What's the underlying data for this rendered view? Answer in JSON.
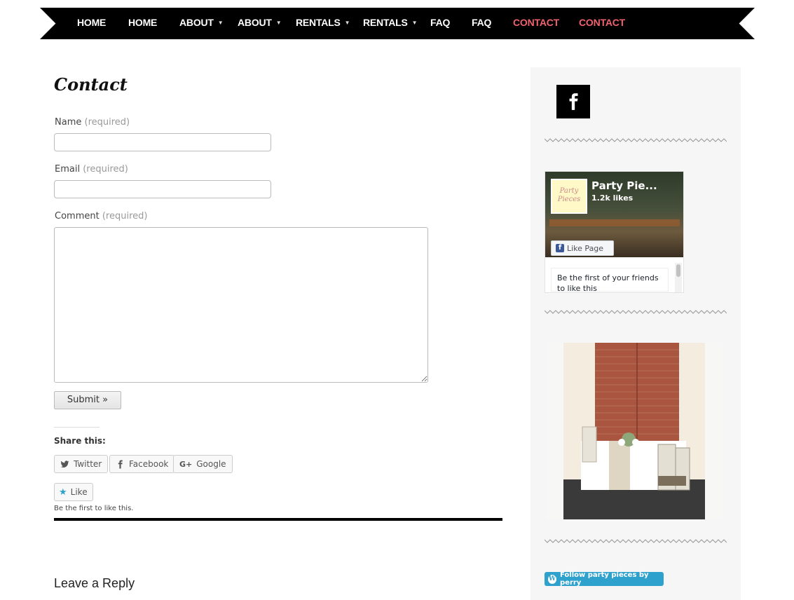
{
  "nav": {
    "items": [
      {
        "label": "HOME",
        "caret": false,
        "active": false
      },
      {
        "label": "HOME",
        "caret": false,
        "active": false
      },
      {
        "label": "ABOUT",
        "caret": true,
        "active": false
      },
      {
        "label": "ABOUT",
        "caret": true,
        "active": false
      },
      {
        "label": "RENTALS",
        "caret": true,
        "active": false
      },
      {
        "label": "RENTALS",
        "caret": true,
        "active": false
      },
      {
        "label": "FAQ",
        "caret": false,
        "active": false
      },
      {
        "label": "FAQ",
        "caret": false,
        "active": false
      },
      {
        "label": "CONTACT",
        "caret": false,
        "active": true
      },
      {
        "label": "CONTACT",
        "caret": false,
        "active": true
      }
    ],
    "caret_glyph": "▼",
    "active_color": "#f0626d"
  },
  "page": {
    "title": "Contact"
  },
  "form": {
    "required_text": "(required)",
    "name_label": "Name",
    "name_value": "",
    "email_label": "Email",
    "email_value": "",
    "comment_label": "Comment",
    "comment_value": "",
    "submit_label": "Submit »"
  },
  "share": {
    "title": "Share this:",
    "twitter": "Twitter",
    "facebook": "Facebook",
    "google": "Google"
  },
  "like": {
    "button_label": "Like",
    "note": "Be the first to like this."
  },
  "comments": {
    "reply_title": "Leave a Reply"
  },
  "sidebar": {
    "facebook_icon": "facebook-icon",
    "fb_page": {
      "name": "Party Pie...",
      "likes": "1.2k likes",
      "logo_text_1": "Party",
      "logo_text_2": "Pieces",
      "like_button": "Like Page",
      "friends_note": "Be the first of your friends to like this"
    },
    "follow_button": "Follow party pieces by perry"
  },
  "colors": {
    "nav_bg": "#000000",
    "sidebar_bg": "#f6f6f6",
    "fb_blue": "#3b5998",
    "follow_blue": "#2ea2cc"
  }
}
